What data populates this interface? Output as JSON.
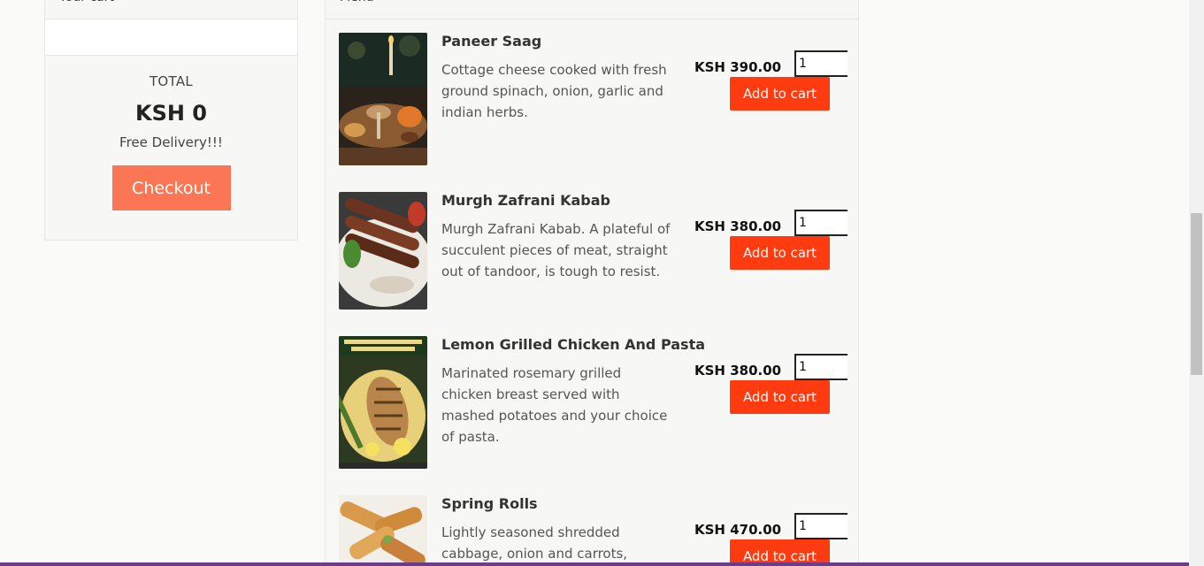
{
  "cart": {
    "header": "Your cart",
    "total_label": "TOTAL",
    "total_value": "KSH 0",
    "delivery": "Free Delivery!!!",
    "checkout_label": "Checkout"
  },
  "menu": {
    "header": "Menu",
    "items": [
      {
        "name": "Paneer Saag",
        "description": "Cottage cheese cooked with fresh ground spinach, onion, garlic and indian herbs.",
        "price": "KSH 390.00",
        "quantity": "1",
        "button": "Add to cart"
      },
      {
        "name": "Murgh Zafrani Kabab",
        "description": "Murgh Zafrani Kabab. A plateful of succulent pieces of meat, straight out of tandoor, is tough to resist.",
        "price": "KSH 380.00",
        "quantity": "1",
        "button": "Add to cart"
      },
      {
        "name": "Lemon Grilled Chicken And Pasta",
        "description": "Marinated rosemary grilled chicken breast served with mashed potatoes and your choice of pasta.",
        "price": "KSH 380.00",
        "quantity": "1",
        "button": "Add to cart"
      },
      {
        "name": "Spring Rolls",
        "description": "Lightly seasoned shredded cabbage, onion and carrots,",
        "price": "KSH 470.00",
        "quantity": "1",
        "button": "Add to cart"
      }
    ]
  },
  "colors": {
    "add_button": "#ff3b0f",
    "checkout_button": "#fa7654"
  }
}
